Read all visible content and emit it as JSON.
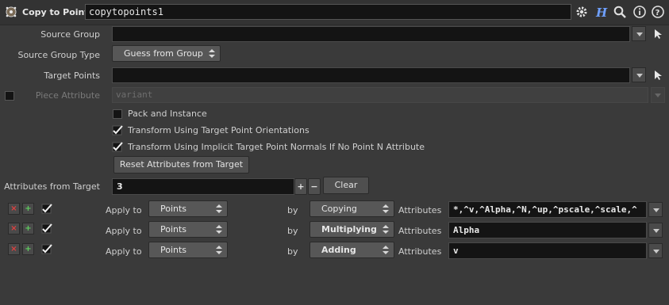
{
  "header": {
    "node_type": "Copy to Points",
    "node_name": "copytopoints1",
    "icons": [
      "gear-icon",
      "help-h-icon",
      "search-icon",
      "info-icon",
      "help-icon"
    ]
  },
  "params": {
    "source_group": {
      "label": "Source Group",
      "value": ""
    },
    "source_group_type": {
      "label": "Source Group Type",
      "value": "Guess from Group"
    },
    "target_points": {
      "label": "Target Points",
      "value": ""
    },
    "piece_attribute": {
      "label": "Piece Attribute",
      "value": "variant",
      "enabled": false
    },
    "pack_and_instance": {
      "label": "Pack and Instance",
      "checked": false
    },
    "transform_orient": {
      "label": "Transform Using Target Point Orientations",
      "checked": true
    },
    "transform_normals": {
      "label": "Transform Using Implicit Target Point Normals If No Point N Attribute",
      "checked": true
    },
    "reset_button": "Reset Attributes from Target",
    "attributes_from_target": {
      "label": "Attributes from Target",
      "value": "3",
      "plus": "+",
      "minus": "−",
      "clear": "Clear"
    }
  },
  "multiparm": {
    "apply_label": "Apply to",
    "by_label": "by",
    "attributes_label": "Attributes",
    "remove_glyph": "×",
    "insert_glyph": "+",
    "rows": [
      {
        "apply_to": "Points",
        "method": "Copying",
        "attributes": "*,^v,^Alpha,^N,^up,^pscale,^scale,^"
      },
      {
        "apply_to": "Points",
        "method": "Multiplying",
        "attributes": "Alpha"
      },
      {
        "apply_to": "Points",
        "method": "Adding",
        "attributes": "v"
      }
    ]
  }
}
